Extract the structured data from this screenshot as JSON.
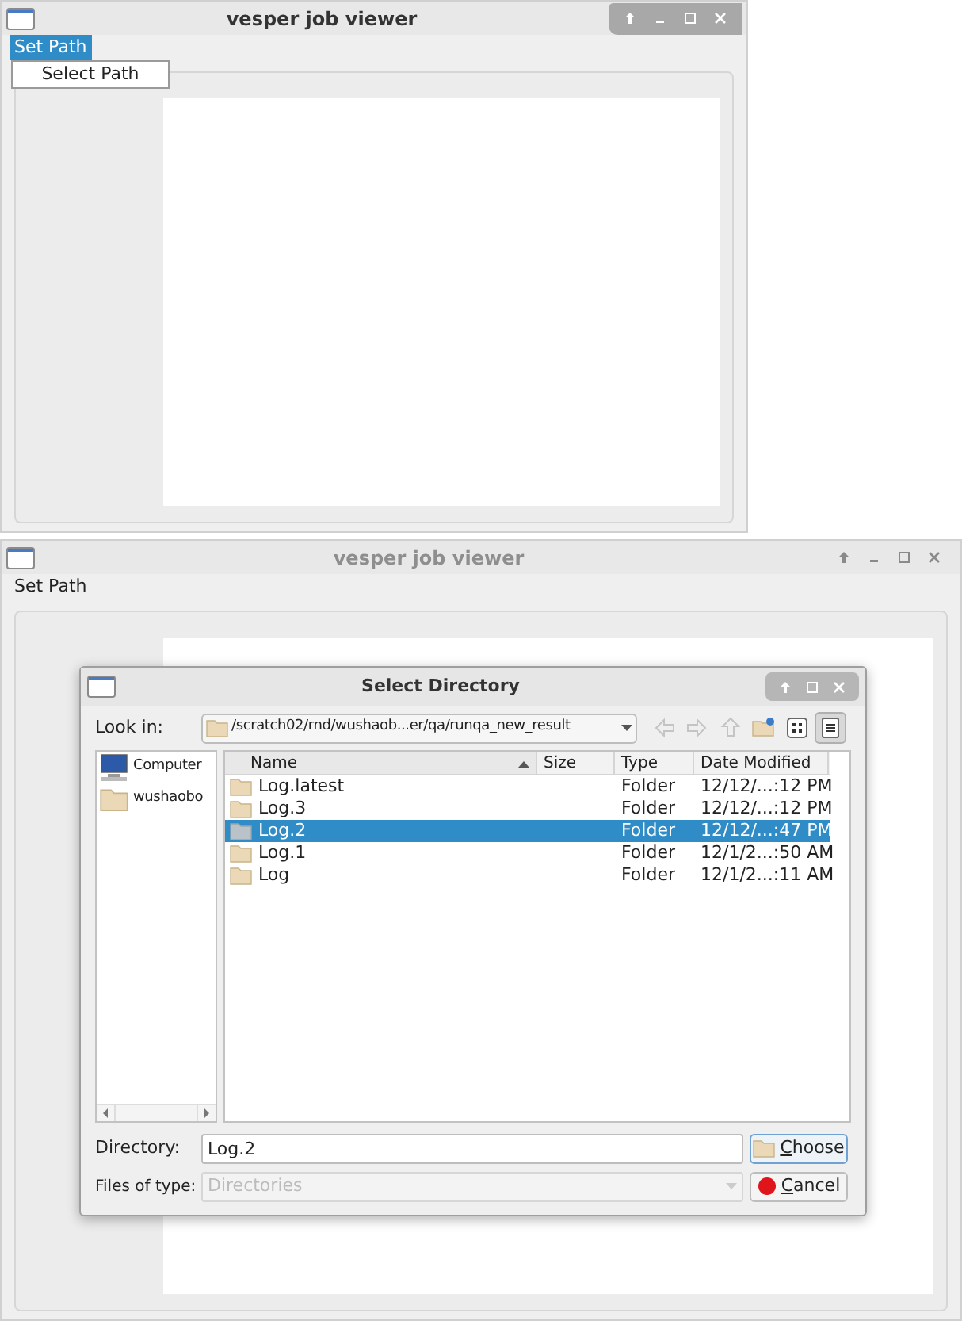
{
  "windows": [
    {
      "title": "vesper job viewer",
      "active": true,
      "menu": [
        {
          "label": "Set Path",
          "selected": true
        }
      ],
      "open_menu": [
        {
          "label": "Select Path"
        }
      ]
    },
    {
      "title": "vesper job viewer",
      "active": false,
      "menu": [
        {
          "label": "Set Path",
          "selected": false
        }
      ]
    }
  ],
  "dialog": {
    "title": "Select Directory",
    "look_in_label": "Look in:",
    "look_in_path": "/scratch02/rnd/wushaob...er/qa/runqa_new_result",
    "toolbar": [
      {
        "kind": "back",
        "disabled": true
      },
      {
        "kind": "forward",
        "disabled": true
      },
      {
        "kind": "up",
        "disabled": true
      },
      {
        "kind": "new-folder",
        "disabled": false
      },
      {
        "kind": "icon-view",
        "selected": false
      },
      {
        "kind": "detail-view",
        "selected": true
      }
    ],
    "places": [
      {
        "kind": "computer",
        "label": "Computer"
      },
      {
        "kind": "folder",
        "label": "wushaobo"
      }
    ],
    "columns": [
      {
        "label": "Name",
        "sorted": true
      },
      {
        "label": "Size",
        "sorted": false
      },
      {
        "label": "Type",
        "sorted": false
      },
      {
        "label": "Date Modified",
        "sorted": false
      }
    ],
    "files": [
      {
        "name": "Log.latest",
        "type": "Folder",
        "date": "12/12/...:12 PM",
        "selected": false
      },
      {
        "name": "Log.3",
        "type": "Folder",
        "date": "12/12/...:12 PM",
        "selected": false
      },
      {
        "name": "Log.2",
        "type": "Folder",
        "date": "12/12/...:47 PM",
        "selected": true
      },
      {
        "name": "Log.1",
        "type": "Folder",
        "date": "12/1/2...:50 AM",
        "selected": false
      },
      {
        "name": "Log",
        "type": "Folder",
        "date": "12/1/2...:11 AM",
        "selected": false
      }
    ],
    "directory_label": "Directory:",
    "directory_value": "Log.2",
    "filetype_label": "Files of type:",
    "filetype_value": "Directories",
    "filetype_disabled": true,
    "buttons": [
      {
        "kind": "choose",
        "label": "Choose",
        "focused": true
      },
      {
        "kind": "cancel",
        "label": "Cancel",
        "focused": false
      }
    ]
  }
}
